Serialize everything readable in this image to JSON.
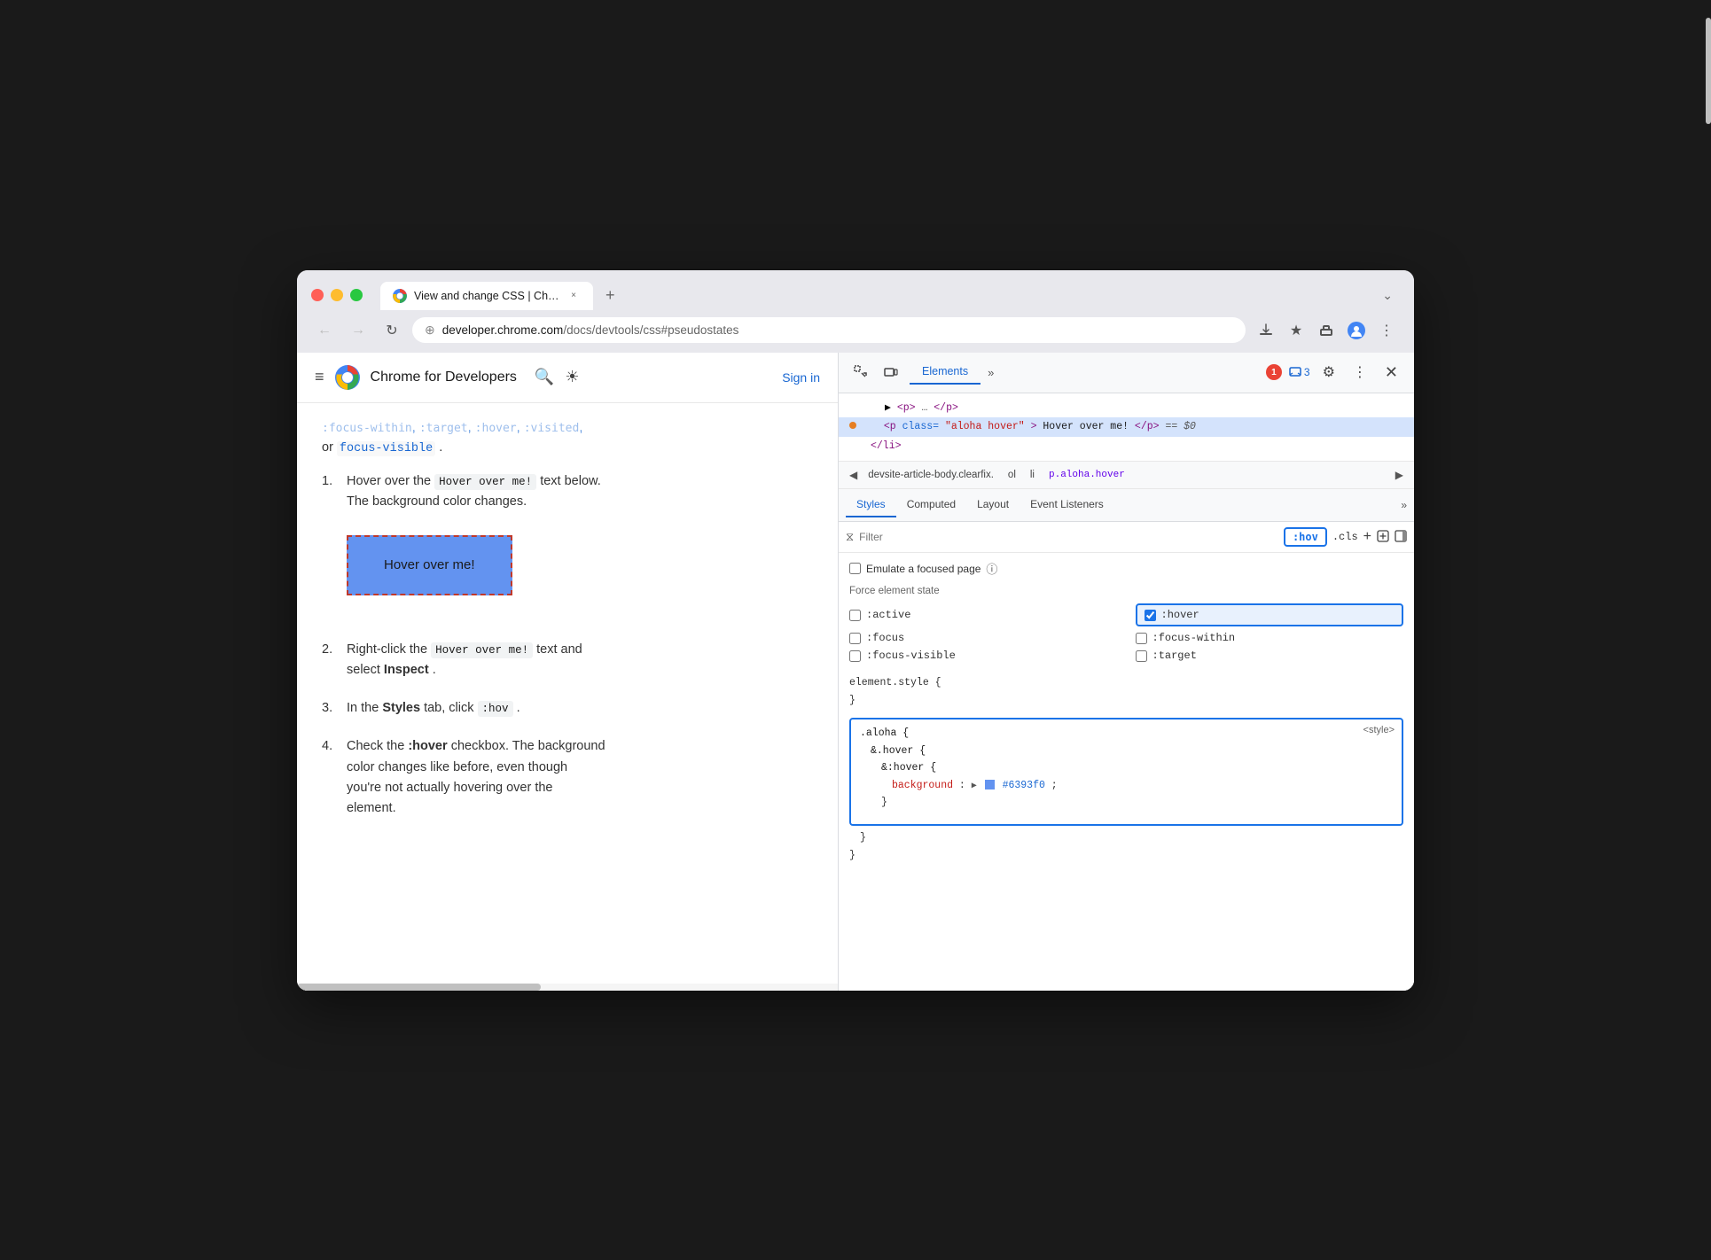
{
  "browser": {
    "traffic_lights": [
      "red",
      "yellow",
      "green"
    ],
    "tab": {
      "favicon": "chrome",
      "title": "View and change CSS | Chr…",
      "close_label": "×"
    },
    "new_tab_label": "+",
    "chevron_label": "⌄",
    "nav": {
      "back_label": "←",
      "forward_label": "→",
      "reload_label": "↻",
      "tune_label": "⊕"
    },
    "address": {
      "full": "developer.chrome.com/docs/devtools/css#pseudostates",
      "domain": "developer.chrome.com",
      "path": "/docs/devtools/css#pseudostates"
    },
    "toolbar": {
      "download_label": "⬇",
      "star_label": "☆",
      "extension_label": "⬡",
      "profile_label": "👤",
      "menu_label": "⋮"
    }
  },
  "site_header": {
    "hamburger_label": "≡",
    "site_name": "Chrome for Developers",
    "search_label": "🔍",
    "theme_label": "☀",
    "sign_in_label": "Sign in"
  },
  "article": {
    "faded_links": ":focus-within, :target, :visited,",
    "or_text": "or",
    "focus_visible_link": "focus-visible",
    "period": ".",
    "list_items": [
      {
        "num": "1.",
        "text_before": "Hover over the",
        "code": "Hover over me!",
        "text_after": "text below. The background color changes."
      },
      {
        "num": "2.",
        "text_before": "Right-click the",
        "code": "Hover over me!",
        "text_after": "text and select",
        "bold_word": "Inspect",
        "period": "."
      },
      {
        "num": "3.",
        "text_before": "In the",
        "bold_styles": "Styles",
        "text_mid": "tab, click",
        "code": ":hov",
        "period": "."
      },
      {
        "num": "4.",
        "text_before": "Check the",
        "bold_word": ":hover",
        "text_after": "checkbox. The background color changes like before, even though you're not actually hovering over the element."
      }
    ],
    "hover_box_label": "Hover over me!"
  },
  "devtools": {
    "header": {
      "inspect_label": "⊹",
      "device_label": "▭",
      "elements_tab": "Elements",
      "more_tabs_label": "»",
      "error_count": "1",
      "message_count": "3",
      "settings_label": "⚙",
      "more_label": "⋮",
      "close_label": "✕"
    },
    "dom_tree": {
      "lines": [
        {
          "content": "▶ <p>…</p>",
          "selected": false
        },
        {
          "content": "<p class=\"aloha hover\">Hover over me!</p> == $0",
          "selected": true,
          "has_dot": true
        },
        {
          "content": "</li>",
          "selected": false
        }
      ]
    },
    "breadcrumb": {
      "left_arrow": "◀",
      "items": [
        "devsite-article-body.clearfix.",
        "ol",
        "li",
        "p.aloha.hover"
      ],
      "right_arrow": "▶"
    },
    "styles_tabs": {
      "tabs": [
        "Styles",
        "Computed",
        "Layout",
        "Event Listeners"
      ],
      "more_label": "»",
      "active": "Styles"
    },
    "filter": {
      "icon_label": "⧖",
      "placeholder": "Filter",
      "hov_label": ":hov",
      "cls_label": ".cls",
      "add_label": "+",
      "new_rule_label": "⊕",
      "toggle_label": "▣"
    },
    "emulate": {
      "checkbox_label": "",
      "label": "Emulate a focused page",
      "help_label": "?"
    },
    "force_state": {
      "label": "Force element state",
      "states": [
        {
          "id": "active",
          "label": ":active",
          "checked": false
        },
        {
          "id": "hover",
          "label": ":hover",
          "checked": true
        },
        {
          "id": "focus",
          "label": ":focus",
          "checked": false
        },
        {
          "id": "focus-within",
          "label": ":focus-within",
          "checked": false
        },
        {
          "id": "focus-visible",
          "label": ":focus-visible",
          "checked": false
        },
        {
          "id": "target",
          "label": ":target",
          "checked": false
        }
      ]
    },
    "css_rules": {
      "element_style": "element.style {",
      "element_style_close": "}",
      "highlighted_rule": {
        "selector_parts": [
          ".aloha {",
          "&.hover {",
          "&:hover {"
        ],
        "property": "background",
        "colon": ":",
        "value": "#6393f0",
        "color_swatch": "#6393f0",
        "semicolon": ";",
        "close_lines": [
          "}",
          "}",
          "}"
        ],
        "source": "<style>"
      }
    }
  }
}
